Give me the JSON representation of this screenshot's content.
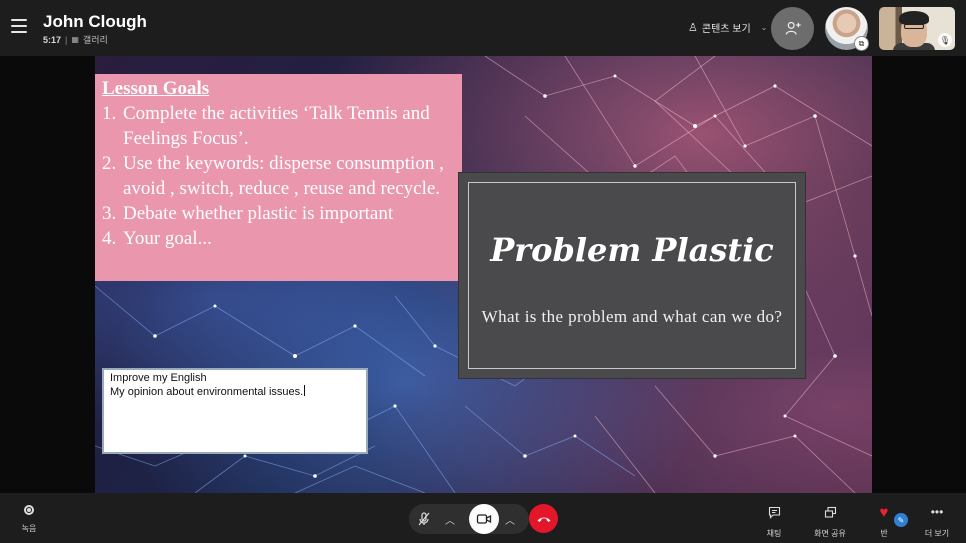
{
  "header": {
    "caller_name": "John Clough",
    "call_duration": "5:17",
    "view_mode": "갤러리",
    "content_view_label": "콘텐츠 보기"
  },
  "slide": {
    "goals_title": "Lesson Goals",
    "goals": [
      {
        "num": "1.",
        "text": "Complete the activities ‘Talk Tennis and Feelings Focus’."
      },
      {
        "num": "2.",
        "text": "Use the keywords: disperse consumption , avoid , switch, reduce , reuse and recycle."
      },
      {
        "num": "3.",
        "text": "Debate whether plastic is important"
      },
      {
        "num": "4.",
        "text": "Your goal..."
      }
    ],
    "answer_lines": [
      "Improve my English",
      "My opinion about environmental issues."
    ],
    "title": "Problem Plastic",
    "subtitle": "What is the problem and what can we do?"
  },
  "bottom_bar": {
    "record_label": "녹음",
    "chat_label": "채팅",
    "share_label": "화면 공유",
    "react_label": "반",
    "more_label": "더 보기"
  },
  "colors": {
    "goals_box": "#ea96ad",
    "title_card": "#4a4a4c",
    "hangup": "#e4162a",
    "react_badge": "#2f7fd6"
  },
  "icons": {
    "menu": "hamburger-icon",
    "add_participant": "add-person-icon",
    "mic": "mic-off-icon",
    "camera": "camera-icon",
    "hangup": "hangup-icon",
    "chat": "chat-icon",
    "share": "screen-share-icon",
    "react": "heart-icon",
    "more": "ellipsis-icon"
  }
}
